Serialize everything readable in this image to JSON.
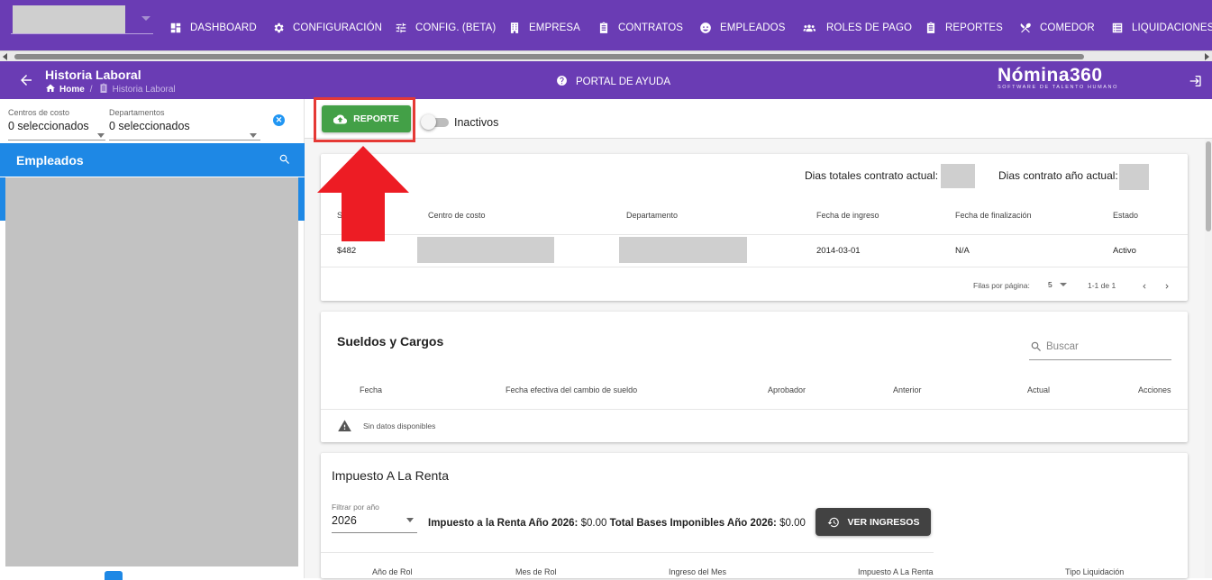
{
  "nav": {
    "items": [
      {
        "label": "DASHBOARD",
        "icon": "dashboard-icon"
      },
      {
        "label": "CONFIGURACIÓN",
        "icon": "gear-icon"
      },
      {
        "label": "CONFIG. (BETA)",
        "icon": "sliders-icon"
      },
      {
        "label": "EMPRESA",
        "icon": "building-icon"
      },
      {
        "label": "CONTRATOS",
        "icon": "clipboard-icon"
      },
      {
        "label": "EMPLEADOS",
        "icon": "employee-icon"
      },
      {
        "label": "ROLES DE PAGO",
        "icon": "group-icon"
      },
      {
        "label": "REPORTES",
        "icon": "report-icon"
      },
      {
        "label": "COMEDOR",
        "icon": "cutlery-icon"
      },
      {
        "label": "LIQUIDACIONES",
        "icon": "list-icon"
      }
    ]
  },
  "header": {
    "title": "Historia Laboral",
    "breadcrumb_home": "Home",
    "breadcrumb_current": "Historia Laboral",
    "help": "PORTAL DE AYUDA",
    "brand_name": "Nómina360",
    "brand_tag": "SOFTWARE DE TALENTO HUMANO"
  },
  "sidebar": {
    "filter_cost_label": "Centros de costo",
    "filter_cost_value": "0 seleccionados",
    "filter_dept_label": "Departamentos",
    "filter_dept_value": "0 seleccionados",
    "clear_symbol": "✕",
    "employees_title": "Empleados"
  },
  "toolbar": {
    "report_label": "REPORTE",
    "inactive_label": "Inactivos"
  },
  "contract": {
    "days_total_label": "Dias totales contrato actual:",
    "days_year_label": "Dias contrato año actual:",
    "columns": [
      "S",
      "Centro de costo",
      "Departamento",
      "Fecha de ingreso",
      "Fecha de finalización",
      "Estado"
    ],
    "row": {
      "salary": "$482",
      "start": "2014-03-01",
      "end": "N/A",
      "status": "Activo"
    },
    "rows_per_page_label": "Filas por página:",
    "rows_per_page_value": "5",
    "range": "1-1 de 1"
  },
  "salaries": {
    "title": "Sueldos y Cargos",
    "search_placeholder": "Buscar",
    "columns": [
      "Fecha",
      "Fecha efectiva del cambio de sueldo",
      "Aprobador",
      "Anterior",
      "Actual",
      "Acciones"
    ],
    "empty": "Sin datos disponibles"
  },
  "tax": {
    "title": "Impuesto A La Renta",
    "filter_label": "Filtrar por año",
    "filter_value": "2026",
    "line_label1": "Impuesto a la Renta Año 2026:",
    "line_value1": "$0.00",
    "line_label2": "Total Bases Imponibles Año 2026:",
    "line_value2": "$0.00",
    "button_label": "VER INGRESOS",
    "columns": [
      "Año de Rol",
      "Mes de Rol",
      "Ingreso del Mes",
      "Impuesto A La Renta",
      "Tipo Liquidación"
    ]
  },
  "colors": {
    "primary": "#6a3cb4",
    "blue": "#1e88e5",
    "green": "#43a047",
    "red": "#e53935"
  }
}
